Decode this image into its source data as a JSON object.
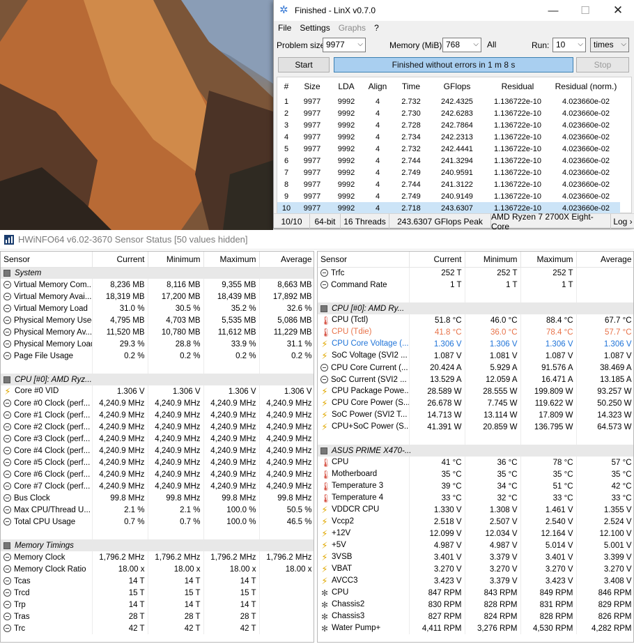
{
  "linx": {
    "title": "Finished - LinX v0.7.0",
    "menu": [
      "File",
      "Settings",
      "Graphs",
      "?"
    ],
    "problem_size_label": "Problem size:",
    "problem_size": "9977",
    "memory_label": "Memory (MiB):",
    "memory": "768",
    "all_label": "All",
    "run_label": "Run:",
    "run": "10",
    "run_unit": "times",
    "start_label": "Start",
    "progress_text": "Finished without errors in 1 m 8 s",
    "stop_label": "Stop",
    "columns": [
      "#",
      "Size",
      "LDA",
      "Align",
      "Time",
      "GFlops",
      "Residual",
      "Residual (norm.)"
    ],
    "rows": [
      [
        "1",
        "9977",
        "9992",
        "4",
        "2.732",
        "242.4325",
        "1.136722e-10",
        "4.023660e-02"
      ],
      [
        "2",
        "9977",
        "9992",
        "4",
        "2.730",
        "242.6283",
        "1.136722e-10",
        "4.023660e-02"
      ],
      [
        "3",
        "9977",
        "9992",
        "4",
        "2.728",
        "242.7864",
        "1.136722e-10",
        "4.023660e-02"
      ],
      [
        "4",
        "9977",
        "9992",
        "4",
        "2.734",
        "242.2313",
        "1.136722e-10",
        "4.023660e-02"
      ],
      [
        "5",
        "9977",
        "9992",
        "4",
        "2.732",
        "242.4441",
        "1.136722e-10",
        "4.023660e-02"
      ],
      [
        "6",
        "9977",
        "9992",
        "4",
        "2.744",
        "241.3294",
        "1.136722e-10",
        "4.023660e-02"
      ],
      [
        "7",
        "9977",
        "9992",
        "4",
        "2.749",
        "240.9591",
        "1.136722e-10",
        "4.023660e-02"
      ],
      [
        "8",
        "9977",
        "9992",
        "4",
        "2.744",
        "241.3122",
        "1.136722e-10",
        "4.023660e-02"
      ],
      [
        "9",
        "9977",
        "9992",
        "4",
        "2.749",
        "240.9149",
        "1.136722e-10",
        "4.023660e-02"
      ],
      [
        "10",
        "9977",
        "9992",
        "4",
        "2.718",
        "243.6307",
        "1.136722e-10",
        "4.023660e-02"
      ]
    ],
    "status": [
      "10/10",
      "64-bit",
      "16 Threads",
      "243.6307 GFlops Peak",
      "AMD Ryzen 7 2700X Eight-Core",
      "Log ›"
    ]
  },
  "hwinfo": {
    "title": "HWiNFO64 v6.02-3670 Sensor Status [50 values hidden]",
    "columns": [
      "Sensor",
      "Current",
      "Minimum",
      "Maximum",
      "Average"
    ],
    "left": [
      {
        "kind": "group",
        "name": "System"
      },
      {
        "kind": "row",
        "icon": "circle",
        "name": "Virtual Memory Com...",
        "v": [
          "8,236 MB",
          "8,116 MB",
          "9,355 MB",
          "8,663 MB"
        ]
      },
      {
        "kind": "row",
        "icon": "circle",
        "name": "Virtual Memory Avai...",
        "v": [
          "18,319 MB",
          "17,200 MB",
          "18,439 MB",
          "17,892 MB"
        ]
      },
      {
        "kind": "row",
        "icon": "circle",
        "name": "Virtual Memory Load",
        "v": [
          "31.0 %",
          "30.5 %",
          "35.2 %",
          "32.6 %"
        ]
      },
      {
        "kind": "row",
        "icon": "circle",
        "name": "Physical Memory Used",
        "v": [
          "4,795 MB",
          "4,703 MB",
          "5,535 MB",
          "5,086 MB"
        ]
      },
      {
        "kind": "row",
        "icon": "circle",
        "name": "Physical Memory Av...",
        "v": [
          "11,520 MB",
          "10,780 MB",
          "11,612 MB",
          "11,229 MB"
        ]
      },
      {
        "kind": "row",
        "icon": "circle",
        "name": "Physical Memory Load",
        "v": [
          "29.3 %",
          "28.8 %",
          "33.9 %",
          "31.1 %"
        ]
      },
      {
        "kind": "row",
        "icon": "circle",
        "name": "Page File Usage",
        "v": [
          "0.2 %",
          "0.2 %",
          "0.2 %",
          "0.2 %"
        ]
      },
      {
        "kind": "spacer"
      },
      {
        "kind": "group",
        "name": "CPU [#0]: AMD Ryz..."
      },
      {
        "kind": "row",
        "icon": "bolt",
        "name": "Core #0 VID",
        "v": [
          "1.306 V",
          "1.306 V",
          "1.306 V",
          "1.306 V"
        ]
      },
      {
        "kind": "row",
        "icon": "circle",
        "name": "Core #0 Clock (perf...",
        "v": [
          "4,240.9 MHz",
          "4,240.9 MHz",
          "4,240.9 MHz",
          "4,240.9 MHz"
        ]
      },
      {
        "kind": "row",
        "icon": "circle",
        "name": "Core #1 Clock (perf...",
        "v": [
          "4,240.9 MHz",
          "4,240.9 MHz",
          "4,240.9 MHz",
          "4,240.9 MHz"
        ]
      },
      {
        "kind": "row",
        "icon": "circle",
        "name": "Core #2 Clock (perf...",
        "v": [
          "4,240.9 MHz",
          "4,240.9 MHz",
          "4,240.9 MHz",
          "4,240.9 MHz"
        ]
      },
      {
        "kind": "row",
        "icon": "circle",
        "name": "Core #3 Clock (perf...",
        "v": [
          "4,240.9 MHz",
          "4,240.9 MHz",
          "4,240.9 MHz",
          "4,240.9 MHz"
        ]
      },
      {
        "kind": "row",
        "icon": "circle",
        "name": "Core #4 Clock (perf...",
        "v": [
          "4,240.9 MHz",
          "4,240.9 MHz",
          "4,240.9 MHz",
          "4,240.9 MHz"
        ]
      },
      {
        "kind": "row",
        "icon": "circle",
        "name": "Core #5 Clock (perf...",
        "v": [
          "4,240.9 MHz",
          "4,240.9 MHz",
          "4,240.9 MHz",
          "4,240.9 MHz"
        ]
      },
      {
        "kind": "row",
        "icon": "circle",
        "name": "Core #6 Clock (perf...",
        "v": [
          "4,240.9 MHz",
          "4,240.9 MHz",
          "4,240.9 MHz",
          "4,240.9 MHz"
        ]
      },
      {
        "kind": "row",
        "icon": "circle",
        "name": "Core #7 Clock (perf...",
        "v": [
          "4,240.9 MHz",
          "4,240.9 MHz",
          "4,240.9 MHz",
          "4,240.9 MHz"
        ]
      },
      {
        "kind": "row",
        "icon": "circle",
        "name": "Bus Clock",
        "v": [
          "99.8 MHz",
          "99.8 MHz",
          "99.8 MHz",
          "99.8 MHz"
        ]
      },
      {
        "kind": "row",
        "icon": "circle",
        "name": "Max CPU/Thread U...",
        "v": [
          "2.1 %",
          "2.1 %",
          "100.0 %",
          "50.5 %"
        ]
      },
      {
        "kind": "row",
        "icon": "circle",
        "name": "Total CPU Usage",
        "v": [
          "0.7 %",
          "0.7 %",
          "100.0 %",
          "46.5 %"
        ]
      },
      {
        "kind": "spacer"
      },
      {
        "kind": "group",
        "name": "Memory Timings"
      },
      {
        "kind": "row",
        "icon": "circle",
        "name": "Memory Clock",
        "v": [
          "1,796.2 MHz",
          "1,796.2 MHz",
          "1,796.2 MHz",
          "1,796.2 MHz"
        ]
      },
      {
        "kind": "row",
        "icon": "circle",
        "name": "Memory Clock Ratio",
        "v": [
          "18.00 x",
          "18.00 x",
          "18.00 x",
          "18.00 x"
        ]
      },
      {
        "kind": "row",
        "icon": "circle",
        "name": "Tcas",
        "v": [
          "14 T",
          "14 T",
          "14 T",
          ""
        ]
      },
      {
        "kind": "row",
        "icon": "circle",
        "name": "Trcd",
        "v": [
          "15 T",
          "15 T",
          "15 T",
          ""
        ]
      },
      {
        "kind": "row",
        "icon": "circle",
        "name": "Trp",
        "v": [
          "14 T",
          "14 T",
          "14 T",
          ""
        ]
      },
      {
        "kind": "row",
        "icon": "circle",
        "name": "Tras",
        "v": [
          "28 T",
          "28 T",
          "28 T",
          ""
        ]
      },
      {
        "kind": "row",
        "icon": "circle",
        "name": "Trc",
        "v": [
          "42 T",
          "42 T",
          "42 T",
          ""
        ]
      }
    ],
    "right": [
      {
        "kind": "row",
        "icon": "circle",
        "name": "Trfc",
        "v": [
          "252 T",
          "252 T",
          "252 T",
          ""
        ]
      },
      {
        "kind": "row",
        "icon": "circle",
        "name": "Command Rate",
        "v": [
          "1 T",
          "1 T",
          "1 T",
          ""
        ]
      },
      {
        "kind": "spacer"
      },
      {
        "kind": "group",
        "name": "CPU [#0]: AMD Ry..."
      },
      {
        "kind": "row",
        "icon": "therm",
        "name": "CPU (Tctl)",
        "v": [
          "51.8 °C",
          "46.0 °C",
          "88.4 °C",
          "67.7 °C"
        ]
      },
      {
        "kind": "row",
        "icon": "therm",
        "name": "CPU (Tdie)",
        "v": [
          "41.8 °C",
          "36.0 °C",
          "78.4 °C",
          "57.7 °C"
        ],
        "hl": "orange"
      },
      {
        "kind": "row",
        "icon": "bolt",
        "name": "CPU Core Voltage (...",
        "v": [
          "1.306 V",
          "1.306 V",
          "1.306 V",
          "1.306 V"
        ],
        "hl": "blue"
      },
      {
        "kind": "row",
        "icon": "bolt",
        "name": "SoC Voltage (SVI2 ...",
        "v": [
          "1.087 V",
          "1.081 V",
          "1.087 V",
          "1.087 V"
        ]
      },
      {
        "kind": "row",
        "icon": "circle",
        "name": "CPU Core Current (...",
        "v": [
          "20.424 A",
          "5.929 A",
          "91.576 A",
          "38.469 A"
        ]
      },
      {
        "kind": "row",
        "icon": "circle",
        "name": "SoC Current (SVI2 ...",
        "v": [
          "13.529 A",
          "12.059 A",
          "16.471 A",
          "13.185 A"
        ]
      },
      {
        "kind": "row",
        "icon": "bolt",
        "name": "CPU Package Powe...",
        "v": [
          "28.589 W",
          "28.555 W",
          "199.809 W",
          "93.257 W"
        ]
      },
      {
        "kind": "row",
        "icon": "bolt",
        "name": "CPU Core Power (S...",
        "v": [
          "26.678 W",
          "7.745 W",
          "119.622 W",
          "50.250 W"
        ]
      },
      {
        "kind": "row",
        "icon": "bolt",
        "name": "SoC Power (SVI2 T...",
        "v": [
          "14.713 W",
          "13.114 W",
          "17.809 W",
          "14.323 W"
        ]
      },
      {
        "kind": "row",
        "icon": "bolt",
        "name": "CPU+SoC Power (S...",
        "v": [
          "41.391 W",
          "20.859 W",
          "136.795 W",
          "64.573 W"
        ]
      },
      {
        "kind": "spacer"
      },
      {
        "kind": "group",
        "name": "ASUS PRIME X470-..."
      },
      {
        "kind": "row",
        "icon": "therm",
        "name": "CPU",
        "v": [
          "41 °C",
          "36 °C",
          "78 °C",
          "57 °C"
        ]
      },
      {
        "kind": "row",
        "icon": "therm",
        "name": "Motherboard",
        "v": [
          "35 °C",
          "35 °C",
          "35 °C",
          "35 °C"
        ]
      },
      {
        "kind": "row",
        "icon": "therm",
        "name": "Temperature 3",
        "v": [
          "39 °C",
          "34 °C",
          "51 °C",
          "42 °C"
        ]
      },
      {
        "kind": "row",
        "icon": "therm",
        "name": "Temperature 4",
        "v": [
          "33 °C",
          "32 °C",
          "33 °C",
          "33 °C"
        ]
      },
      {
        "kind": "row",
        "icon": "bolt",
        "name": "VDDCR CPU",
        "v": [
          "1.330 V",
          "1.308 V",
          "1.461 V",
          "1.355 V"
        ]
      },
      {
        "kind": "row",
        "icon": "bolt",
        "name": "Vccp2",
        "v": [
          "2.518 V",
          "2.507 V",
          "2.540 V",
          "2.524 V"
        ]
      },
      {
        "kind": "row",
        "icon": "bolt",
        "name": "+12V",
        "v": [
          "12.099 V",
          "12.034 V",
          "12.164 V",
          "12.100 V"
        ]
      },
      {
        "kind": "row",
        "icon": "bolt",
        "name": "+5V",
        "v": [
          "4.987 V",
          "4.987 V",
          "5.014 V",
          "5.001 V"
        ]
      },
      {
        "kind": "row",
        "icon": "bolt",
        "name": "3VSB",
        "v": [
          "3.401 V",
          "3.379 V",
          "3.401 V",
          "3.399 V"
        ]
      },
      {
        "kind": "row",
        "icon": "bolt",
        "name": "VBAT",
        "v": [
          "3.270 V",
          "3.270 V",
          "3.270 V",
          "3.270 V"
        ]
      },
      {
        "kind": "row",
        "icon": "bolt",
        "name": "AVCC3",
        "v": [
          "3.423 V",
          "3.379 V",
          "3.423 V",
          "3.408 V"
        ]
      },
      {
        "kind": "row",
        "icon": "fan",
        "name": "CPU",
        "v": [
          "847 RPM",
          "843 RPM",
          "849 RPM",
          "846 RPM"
        ]
      },
      {
        "kind": "row",
        "icon": "fan",
        "name": "Chassis2",
        "v": [
          "830 RPM",
          "828 RPM",
          "831 RPM",
          "829 RPM"
        ]
      },
      {
        "kind": "row",
        "icon": "fan",
        "name": "Chassis3",
        "v": [
          "827 RPM",
          "824 RPM",
          "828 RPM",
          "826 RPM"
        ]
      },
      {
        "kind": "row",
        "icon": "fan",
        "name": "Water Pump+",
        "v": [
          "4,411 RPM",
          "3,276 RPM",
          "4,530 RPM",
          "4,282 RPM"
        ]
      }
    ]
  }
}
